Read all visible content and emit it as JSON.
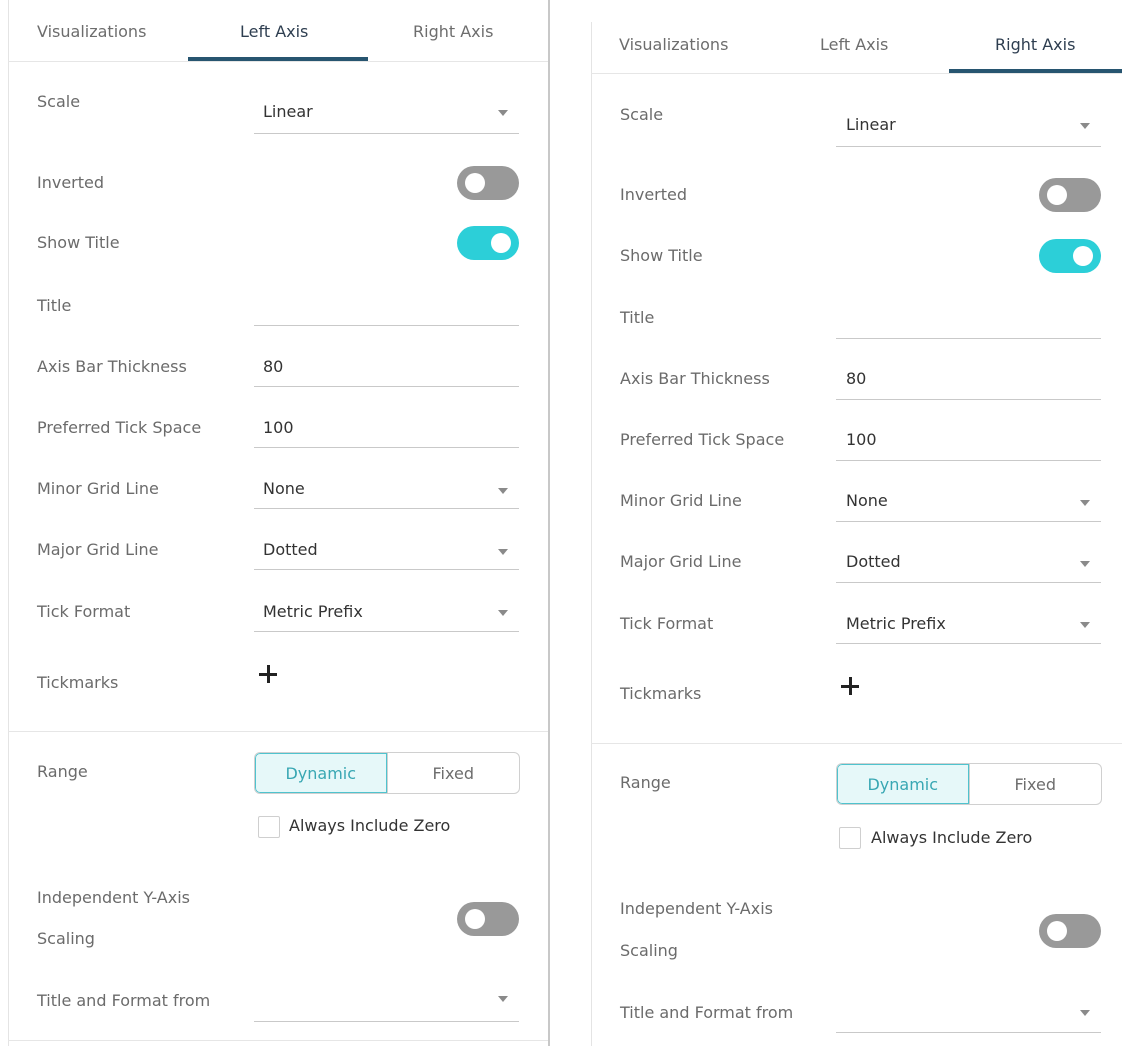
{
  "tabs": [
    "Visualizations",
    "Left Axis",
    "Right Axis"
  ],
  "panels": [
    {
      "id": "left-axis-panel",
      "active_tab": "Left Axis",
      "scale": {
        "label": "Scale",
        "value": "Linear"
      },
      "inverted": {
        "label": "Inverted",
        "on": false
      },
      "show_title": {
        "label": "Show Title",
        "on": true
      },
      "title": {
        "label": "Title",
        "value": ""
      },
      "axis_bar_thickness": {
        "label": "Axis Bar Thickness",
        "value": "80"
      },
      "preferred_tick_space": {
        "label": "Preferred Tick Space",
        "value": "100"
      },
      "minor_grid_line": {
        "label": "Minor Grid Line",
        "value": "None"
      },
      "major_grid_line": {
        "label": "Major Grid Line",
        "value": "Dotted"
      },
      "tick_format": {
        "label": "Tick Format",
        "value": "Metric Prefix"
      },
      "tickmarks": {
        "label": "Tickmarks",
        "add_icon": "plus-icon"
      },
      "range": {
        "label": "Range",
        "options": [
          "Dynamic",
          "Fixed"
        ],
        "selected": "Dynamic"
      },
      "always_include_zero": {
        "label": "Always Include Zero",
        "checked": false
      },
      "independent_scaling": {
        "label_line1": "Independent Y-Axis",
        "label_line2": "Scaling",
        "on": false
      },
      "title_format_from": {
        "label": "Title and Format from",
        "value": ""
      }
    },
    {
      "id": "right-axis-panel",
      "active_tab": "Right Axis",
      "scale": {
        "label": "Scale",
        "value": "Linear"
      },
      "inverted": {
        "label": "Inverted",
        "on": false
      },
      "show_title": {
        "label": "Show Title",
        "on": true
      },
      "title": {
        "label": "Title",
        "value": ""
      },
      "axis_bar_thickness": {
        "label": "Axis Bar Thickness",
        "value": "80"
      },
      "preferred_tick_space": {
        "label": "Preferred Tick Space",
        "value": "100"
      },
      "minor_grid_line": {
        "label": "Minor Grid Line",
        "value": "None"
      },
      "major_grid_line": {
        "label": "Major Grid Line",
        "value": "Dotted"
      },
      "tick_format": {
        "label": "Tick Format",
        "value": "Metric Prefix"
      },
      "tickmarks": {
        "label": "Tickmarks",
        "add_icon": "plus-icon"
      },
      "range": {
        "label": "Range",
        "options": [
          "Dynamic",
          "Fixed"
        ],
        "selected": "Dynamic"
      },
      "always_include_zero": {
        "label": "Always Include Zero",
        "checked": false
      },
      "independent_scaling": {
        "label_line1": "Independent Y-Axis",
        "label_line2": "Scaling",
        "on": false
      },
      "title_format_from": {
        "label": "Title and Format from",
        "value": ""
      }
    }
  ],
  "colors": {
    "accent": "#2ccfd8",
    "tab_underline": "#275570",
    "toggle_off": "#999999",
    "segment_active_bg": "#e6f8f9",
    "segment_active_text": "#38a7b3"
  }
}
